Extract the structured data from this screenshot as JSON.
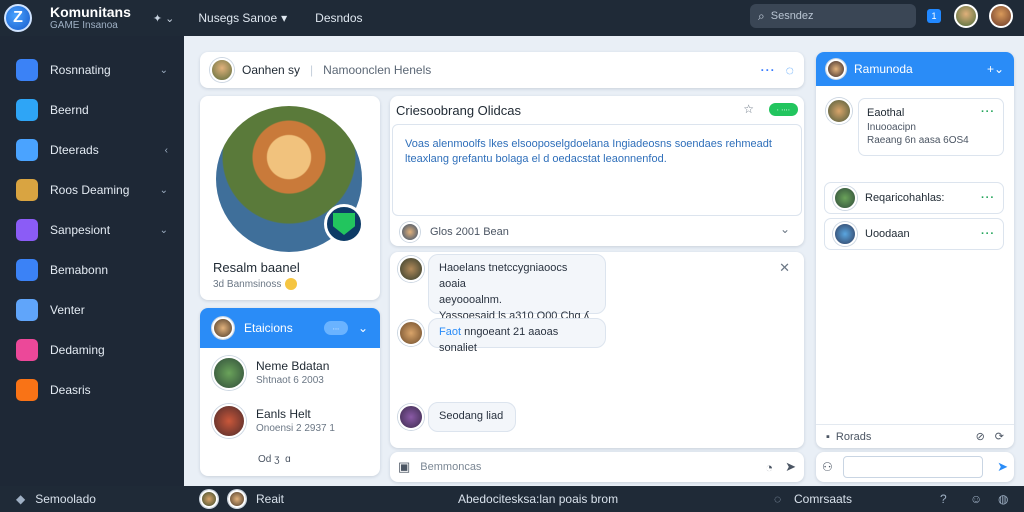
{
  "app": {
    "name": "Komunitans",
    "subtitle": "GAME Insanoa"
  },
  "top": {
    "menu": "Nusegs Sanoe",
    "menu2": "Desndos",
    "search_placeholder": "Sesndez",
    "badge": "1"
  },
  "sidebar": {
    "items": [
      {
        "label": "Rosnnating",
        "chev": "⌄",
        "color": "#3b82f6"
      },
      {
        "label": "Beernd",
        "chev": "",
        "color": "#2ea5f6"
      },
      {
        "label": "Dteerads",
        "chev": "‹",
        "color": "#4aa3ff"
      },
      {
        "label": "Roos Deaming",
        "chev": "⌄",
        "color": "#d9a441"
      },
      {
        "label": "Sanpesiont",
        "chev": "⌄",
        "color": "#8b5cf6"
      },
      {
        "label": "Bemabonn",
        "chev": "",
        "color": "#3b82f6"
      },
      {
        "label": "Venter",
        "chev": "",
        "color": "#60a5fa"
      },
      {
        "label": "Dedaming",
        "chev": "",
        "color": "#ec4899"
      },
      {
        "label": "Deasris",
        "chev": "",
        "color": "#f97316"
      }
    ]
  },
  "conversation": {
    "name": "Oanhen sy",
    "channel": "Namoonclen Henels"
  },
  "profile": {
    "name": "Resalm baanel",
    "sub": "3d Banmsinoss"
  },
  "friends": {
    "title": "Etaicions",
    "pill": "∙∙∙",
    "list": [
      {
        "name": "Neme Bdatan",
        "sub": "Shtnaot 6 2003"
      },
      {
        "name": "Eanls Helt",
        "sub": "Onoensi 2 2937 1"
      }
    ],
    "footer": "Od ʒ  ɑ"
  },
  "post": {
    "title": "Criesoobrang Olidcas",
    "pill": "∙ ∙∙∙∙",
    "body": "Voas alenmoolfs lkes elsooposelgdoelana Ingiadeosns soendaes rehmeadt lteaxlang grefantu bolaga el d oedacstat leaonnenfod.",
    "meta": "Glos 2001 Bean"
  },
  "chat": {
    "messages": [
      {
        "lines": [
          "Haoelans tnetccygniaoocs aoaia",
          "aeyoooalnm.",
          "Yassoesaid ls a310 O00 Chg ʎ"
        ]
      },
      {
        "link": "Faot",
        "text": "nngoeant 21 aaoas sonaliet"
      },
      {
        "text": "Seodang liad"
      }
    ]
  },
  "composer": {
    "placeholder": "Bemmoncas"
  },
  "members": {
    "title": "Ramunoda",
    "cards": [
      {
        "lines": [
          "Eaothal",
          "Inuooacipn",
          "Raeang 6n aasa 6OS4"
        ]
      },
      {
        "lines": [
          "Reqaricohahlas:"
        ]
      },
      {
        "lines": [
          "Uoodaan"
        ]
      }
    ],
    "footer": "Rorads"
  },
  "bottombar": {
    "left": "Semoolado",
    "mid": "Reait",
    "center": "Abedocitesksa:lan poais brom",
    "right": "Comrsaats"
  }
}
